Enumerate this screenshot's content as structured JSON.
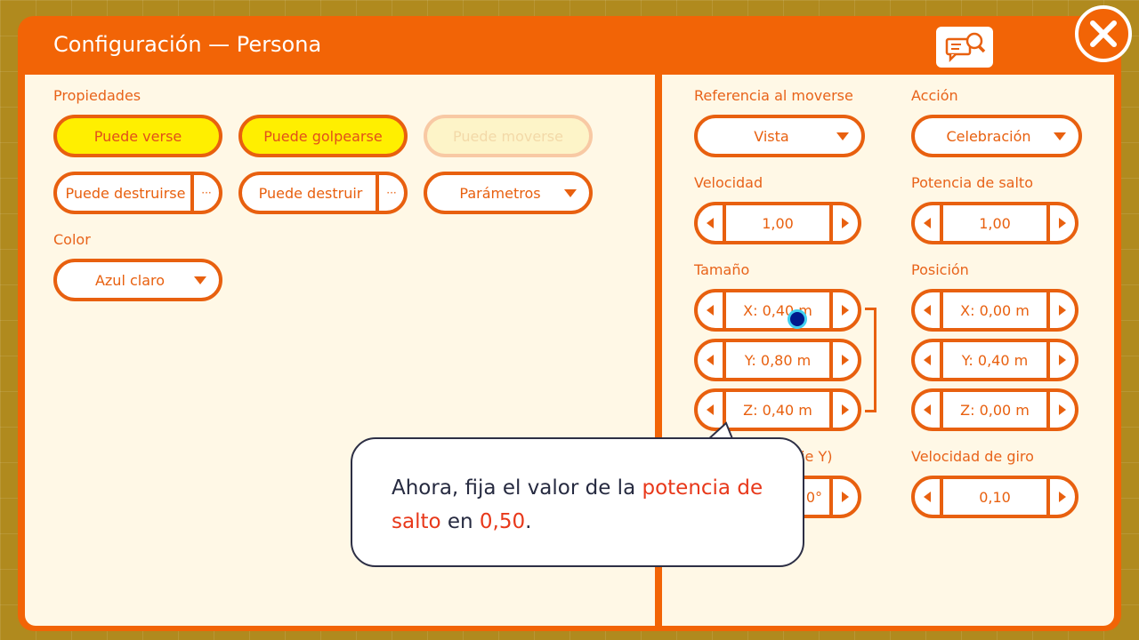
{
  "window": {
    "title": "Configuración — Persona"
  },
  "help_icon": "help-search-icon",
  "close_icon": "close-icon",
  "left": {
    "properties_label": "Propiedades",
    "toggles": [
      "Puede verse",
      "Puede golpearse",
      "Puede moverse"
    ],
    "split_buttons": [
      "Puede destruirse",
      "Puede destruir"
    ],
    "split_more": "···",
    "params_dropdown": "Parámetros",
    "color_label": "Color",
    "color_value": "Azul claro"
  },
  "right": {
    "move_ref_label": "Referencia al moverse",
    "move_ref_value": "Vista",
    "action_label": "Acción",
    "action_value": "Celebración",
    "speed_label": "Velocidad",
    "speed_value": "1,00",
    "jump_label": "Potencia de salto",
    "jump_value": "1,00",
    "size_label": "Tamaño",
    "size_x": "X: 0,40 m",
    "size_y": "Y: 0,80 m",
    "size_z": "Z: 0,40 m",
    "position_label": "Posición",
    "pos_x": "X: 0,00 m",
    "pos_y": "Y: 0,40 m",
    "pos_z": "Z: 0,00 m",
    "rotation_label_visible": "(eje Y)",
    "rotation_value_visible": "0°",
    "turn_speed_label": "Velocidad de giro",
    "turn_speed_value": "0,10"
  },
  "tooltip": {
    "text_1": "Ahora, fija el valor de la ",
    "hl_1": "potencia de salto",
    "text_2": " en ",
    "hl_2": "0,50",
    "text_3": "."
  },
  "colors": {
    "accent": "#f26406",
    "panel_bg": "#fff8e6",
    "toggle_on": "#ffef00",
    "highlight_text": "#e8381a"
  }
}
